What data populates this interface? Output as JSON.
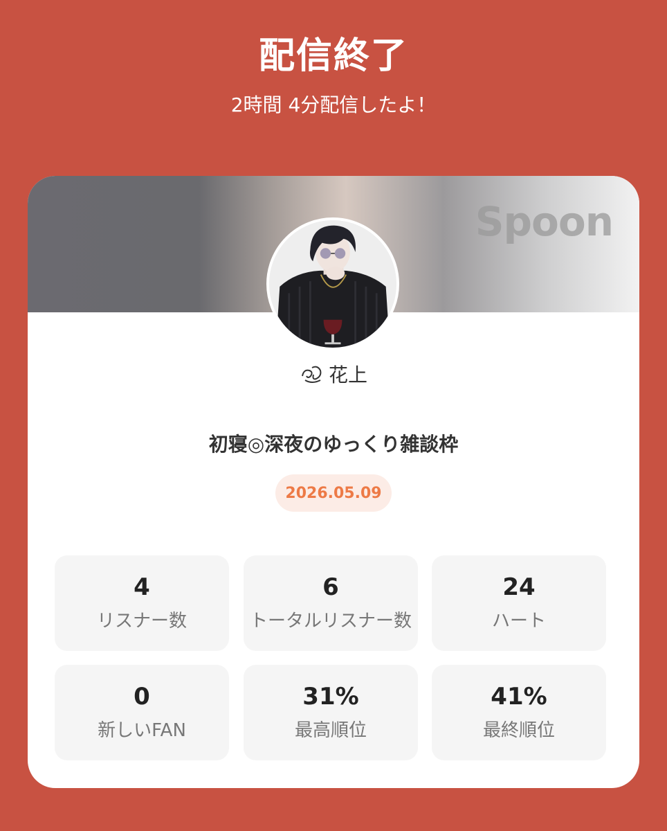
{
  "header": {
    "title": "配信終了",
    "subtitle": "2時間 4分配信したよ！"
  },
  "card": {
    "brand": "Spoon",
    "user_name": "花上",
    "deco_icon": "swirl-decoration-icon",
    "stream_title": "初寝◎深夜のゆっくり雑談枠",
    "date": "2026.05.09",
    "stats": [
      {
        "value": "4",
        "label": "リスナー数"
      },
      {
        "value": "6",
        "label": "トータルリスナー数"
      },
      {
        "value": "24",
        "label": "ハート"
      },
      {
        "value": "0",
        "label": "新しいFAN"
      },
      {
        "value": "31%",
        "label": "最高順位"
      },
      {
        "value": "41%",
        "label": "最終順位"
      }
    ]
  },
  "colors": {
    "background": "#c85242",
    "date_text": "#ed7a46",
    "date_badge_bg": "#fcece6",
    "stat_tile_bg": "#f5f5f5"
  }
}
